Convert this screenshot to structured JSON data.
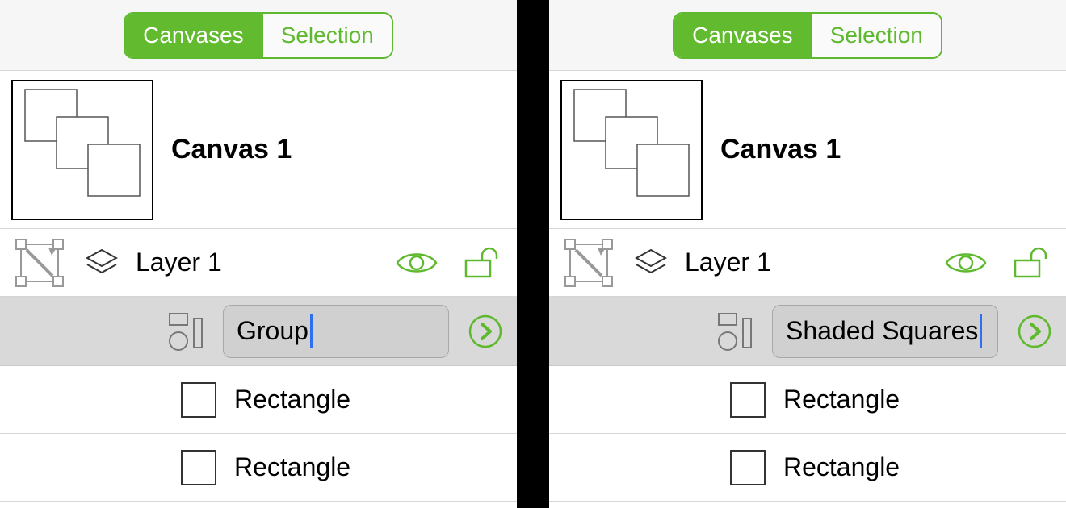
{
  "left": {
    "tabs": {
      "canvases": "Canvases",
      "selection": "Selection"
    },
    "canvas_title": "Canvas 1",
    "layer_label": "Layer 1",
    "group_value": "Group",
    "rect1": "Rectangle",
    "rect2": "Rectangle"
  },
  "right": {
    "tabs": {
      "canvases": "Canvases",
      "selection": "Selection"
    },
    "canvas_title": "Canvas 1",
    "layer_label": "Layer 1",
    "group_value": "Shaded Squares",
    "rect1": "Rectangle",
    "rect2": "Rectangle"
  },
  "colors": {
    "accent": "#5fb92e"
  }
}
